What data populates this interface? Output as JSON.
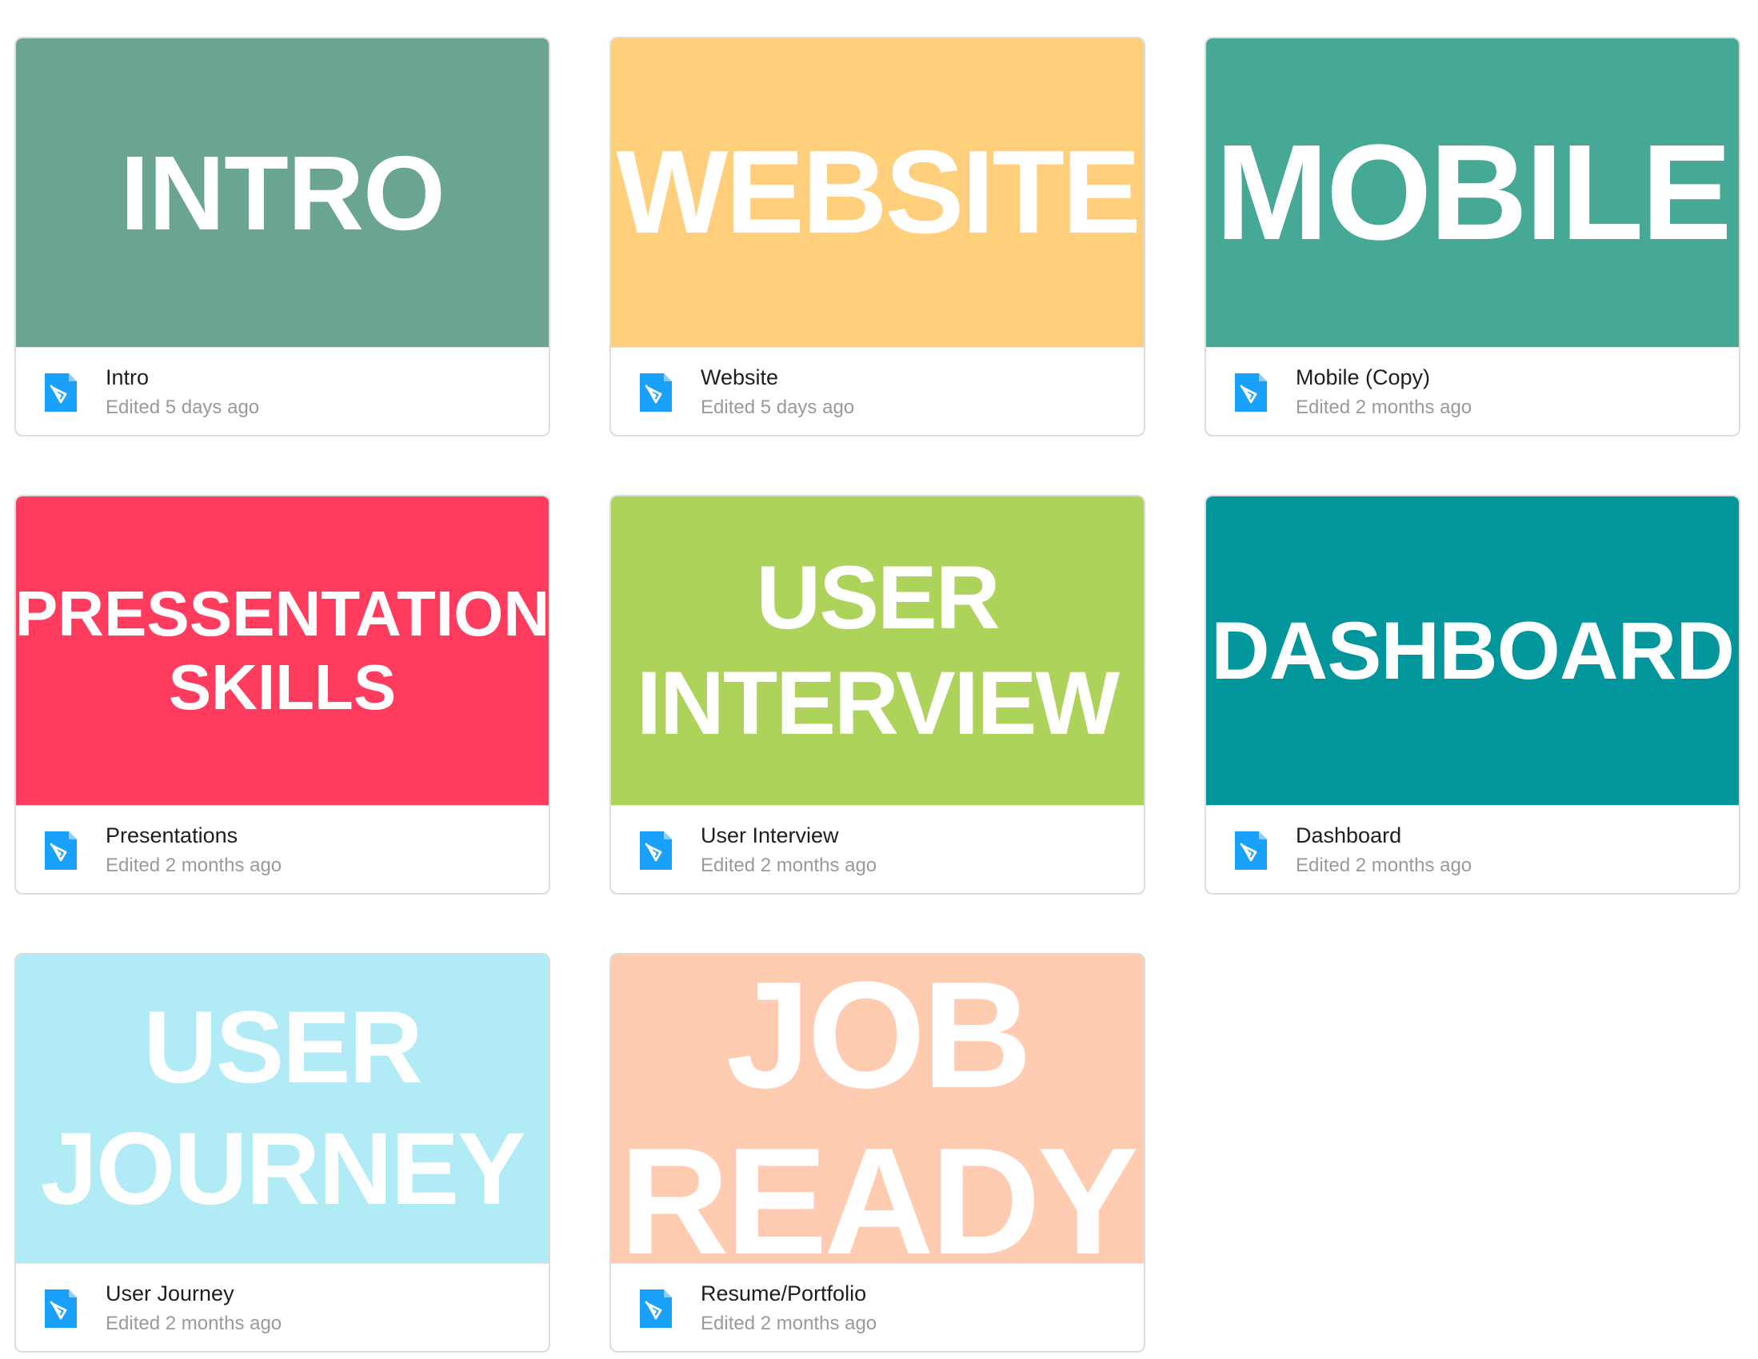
{
  "files": [
    {
      "thumbnail_text": "INTRO",
      "thumbnail_color": "#6aa592",
      "name": "Intro",
      "edited": "Edited 5 days ago",
      "icon": "figma-file-icon"
    },
    {
      "thumbnail_text": "WEBSITE",
      "thumbnail_color": "#ffcf7c",
      "name": "Website",
      "edited": "Edited 5 days ago",
      "icon": "figma-file-icon"
    },
    {
      "thumbnail_text": "MOBILE",
      "thumbnail_color": "#45a996",
      "name": "Mobile (Copy)",
      "edited": "Edited 2 months ago",
      "icon": "figma-file-icon"
    },
    {
      "thumbnail_text": "PRESSENTATION\nSKILLS",
      "thumbnail_color": "#ff3b5e",
      "name": "Presentations",
      "edited": "Edited 2 months ago",
      "icon": "figma-file-icon"
    },
    {
      "thumbnail_text": "USER\nINTERVIEW",
      "thumbnail_color": "#add35b",
      "name": "User Interview",
      "edited": "Edited 2 months ago",
      "icon": "figma-file-icon"
    },
    {
      "thumbnail_text": "DASHBOARD",
      "thumbnail_color": "#00969c",
      "name": "Dashboard",
      "edited": "Edited 2 months ago",
      "icon": "figma-file-icon"
    },
    {
      "thumbnail_text": "USER\nJOURNEY",
      "thumbnail_color": "#b0ebf6",
      "name": "User Journey",
      "edited": "Edited 2 months ago",
      "icon": "figma-file-icon"
    },
    {
      "thumbnail_text": "JOB\nREADY",
      "thumbnail_color": "#ffcbb1",
      "name": "Resume/Portfolio",
      "edited": "Edited 2 months ago",
      "icon": "figma-file-icon"
    }
  ],
  "colors": {
    "file_icon": "#18a0fb",
    "border": "#dcdcdc",
    "name_text": "#1e1e1e",
    "meta_text": "#9a9a9a"
  }
}
